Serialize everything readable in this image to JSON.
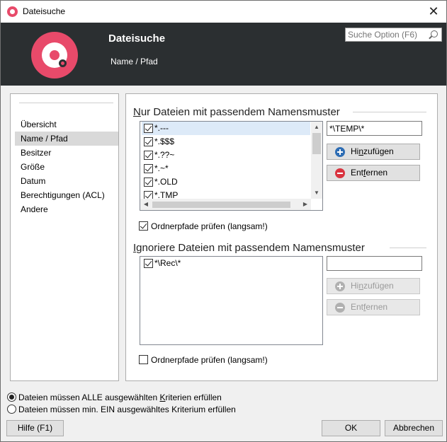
{
  "window": {
    "title": "Dateisuche",
    "close_glyph": "✕"
  },
  "header": {
    "title": "Dateisuche",
    "subtitle": "Name / Pfad",
    "search_placeholder": "Suche Option (F6)"
  },
  "nav": {
    "items": [
      {
        "label": "Übersicht",
        "selected": false
      },
      {
        "label": "Name / Pfad",
        "selected": true
      },
      {
        "label": "Besitzer",
        "selected": false
      },
      {
        "label": "Größe",
        "selected": false
      },
      {
        "label": "Datum",
        "selected": false
      },
      {
        "label": "Berechtigungen (ACL)",
        "selected": false
      },
      {
        "label": "Andere",
        "selected": false
      }
    ]
  },
  "include": {
    "title_prefix": "N",
    "title_rest": "ur Dateien mit passendem Namensmuster",
    "patterns": [
      {
        "text": "*.---",
        "checked": true
      },
      {
        "text": "*.$$$",
        "checked": true
      },
      {
        "text": "*.??~",
        "checked": true
      },
      {
        "text": "*.~*",
        "checked": true
      },
      {
        "text": "*.OLD",
        "checked": true
      },
      {
        "text": "*.TMP",
        "checked": true
      }
    ],
    "input_value": "*\\TEMP\\*",
    "add_label_pre": "Hi",
    "add_label_ul": "n",
    "add_label_post": "zufügen",
    "remove_label_pre": "Ent",
    "remove_label_ul": "f",
    "remove_label_post": "ernen",
    "check_paths_label": "Ordnerpfade prüfen (langsam!)",
    "check_paths_checked": true
  },
  "exclude": {
    "title_prefix": "I",
    "title_rest": "gnoriere Dateien mit passendem Namensmuster",
    "patterns": [
      {
        "text": "*\\Rec\\*",
        "checked": true
      }
    ],
    "input_value": "",
    "add_label_pre": "Hi",
    "add_label_ul": "n",
    "add_label_post": "zufügen",
    "remove_label_pre": "Ent",
    "remove_label_ul": "f",
    "remove_label_post": "ernen",
    "check_paths_label": "Ordnerpfade prüfen (langsam!)",
    "check_paths_checked": false
  },
  "criteria": {
    "all_pre": "Dateien müssen ALLE ausgewählten ",
    "all_ul": "K",
    "all_post": "riterien erfüllen",
    "any_label": "Dateien müssen min. EIN ausgewähltes Kriterium erfüllen",
    "selected": "all"
  },
  "footer": {
    "help_label": "Hilfe (F1)",
    "ok_label": "OK",
    "cancel_label": "Abbrechen"
  },
  "colors": {
    "accent": "#e84a6a",
    "header_bg": "#2b2f31",
    "add_icon": "#2e6db4",
    "remove_icon": "#d9333f"
  },
  "icons": {
    "app": "app-logo-icon",
    "search": "search-icon",
    "add": "plus-circle-icon",
    "remove": "minus-circle-icon"
  }
}
